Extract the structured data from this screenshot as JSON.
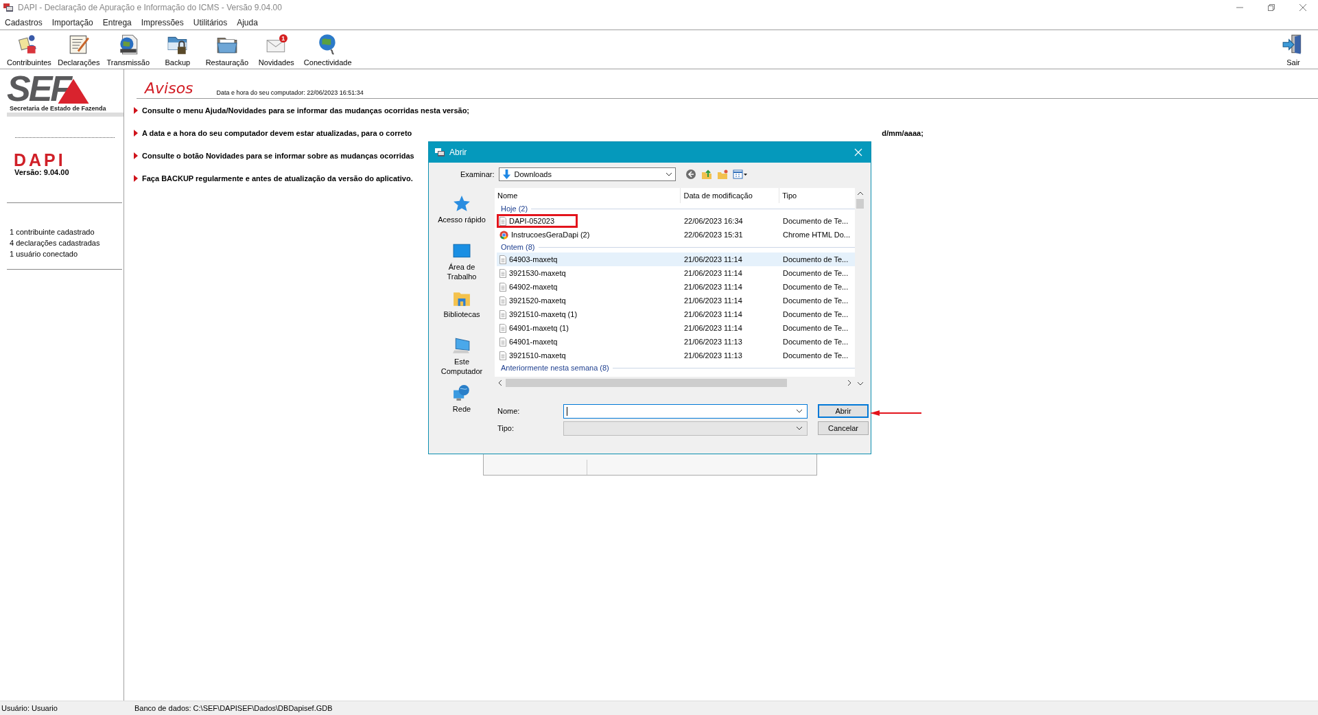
{
  "window": {
    "title": "DAPI - Declaração de Apuração e Informação do ICMS - Versão 9.04.00"
  },
  "menu": [
    "Cadastros",
    "Importação",
    "Entrega",
    "Impressões",
    "Utilitários",
    "Ajuda"
  ],
  "toolbar": [
    {
      "label": "Contribuintes"
    },
    {
      "label": "Declarações"
    },
    {
      "label": "Transmissão"
    },
    {
      "label": "Backup"
    },
    {
      "label": "Restauração"
    },
    {
      "label": "Novidades",
      "badge": "1"
    },
    {
      "label": "Conectividade"
    }
  ],
  "exit_button": {
    "label": "Sair"
  },
  "sidebar": {
    "logo": "SEF",
    "logo_subtitle": "Secretaria de Estado de Fazenda",
    "app_name": "DAPI",
    "version": "Versão: 9.04.00",
    "stats": [
      "1 contribuinte cadastrado",
      "4 declarações cadastradas",
      "1 usuário conectado"
    ]
  },
  "notices": {
    "title": "Avisos",
    "datetime": "Data e hora do seu computador: 22/06/2023 16:51:34",
    "items": [
      {
        "text": "Consulte o menu Ajuda/Novidades para se informar das mudanças ocorridas nesta versão;"
      },
      {
        "text": "A data e a hora do seu computador devem estar atualizadas, para o correto",
        "tail": "d/mm/aaaa;"
      },
      {
        "text": "Consulte o botão Novidades para se informar sobre as mudanças ocorridas"
      },
      {
        "text": "Faça BACKUP regularmente e antes de atualização da versão do aplicativo."
      }
    ]
  },
  "dialog": {
    "title": "Abrir",
    "look_in_label": "Examinar:",
    "look_in": "Downloads",
    "places": [
      "Acesso rápido",
      "Área de Trabalho",
      "Bibliotecas",
      "Este Computador",
      "Rede"
    ],
    "columns": [
      "Nome",
      "Data de modificação",
      "Tipo"
    ],
    "groups": [
      {
        "label": "Hoje (2)",
        "files": [
          {
            "name": "DAPI-052023",
            "date": "22/06/2023 16:34",
            "type": "Documento de Te...",
            "kind": "text",
            "selected": false,
            "annotated": true
          },
          {
            "name": "InstrucoesGeraDapi (2)",
            "date": "22/06/2023 15:31",
            "type": "Chrome HTML Do...",
            "kind": "html",
            "selected": false,
            "annotated": false
          }
        ]
      },
      {
        "label": "Ontem (8)",
        "files": [
          {
            "name": "64903-maxetq",
            "date": "21/06/2023 11:14",
            "type": "Documento de Te...",
            "kind": "text",
            "selected": true,
            "annotated": false
          },
          {
            "name": "3921530-maxetq",
            "date": "21/06/2023 11:14",
            "type": "Documento de Te...",
            "kind": "text",
            "selected": false,
            "annotated": false
          },
          {
            "name": "64902-maxetq",
            "date": "21/06/2023 11:14",
            "type": "Documento de Te...",
            "kind": "text",
            "selected": false,
            "annotated": false
          },
          {
            "name": "3921520-maxetq",
            "date": "21/06/2023 11:14",
            "type": "Documento de Te...",
            "kind": "text",
            "selected": false,
            "annotated": false
          },
          {
            "name": "3921510-maxetq (1)",
            "date": "21/06/2023 11:14",
            "type": "Documento de Te...",
            "kind": "text",
            "selected": false,
            "annotated": false
          },
          {
            "name": "64901-maxetq (1)",
            "date": "21/06/2023 11:14",
            "type": "Documento de Te...",
            "kind": "text",
            "selected": false,
            "annotated": false
          },
          {
            "name": "64901-maxetq",
            "date": "21/06/2023 11:13",
            "type": "Documento de Te...",
            "kind": "text",
            "selected": false,
            "annotated": false
          },
          {
            "name": "3921510-maxetq",
            "date": "21/06/2023 11:13",
            "type": "Documento de Te...",
            "kind": "text",
            "selected": false,
            "annotated": false
          }
        ]
      },
      {
        "label": "Anteriormente nesta semana (8)"
      }
    ],
    "name_label": "Nome:",
    "type_label": "Tipo:",
    "type_disabled": true,
    "buttons": [
      {
        "label": "Abrir",
        "default": true
      },
      {
        "label": "Cancelar",
        "default": false
      }
    ]
  },
  "status_bar": {
    "user": "Usuário: Usuario",
    "database": "Banco de dados: C:\\SEF\\DAPISEF\\Dados\\DBDapisef.GDB"
  }
}
